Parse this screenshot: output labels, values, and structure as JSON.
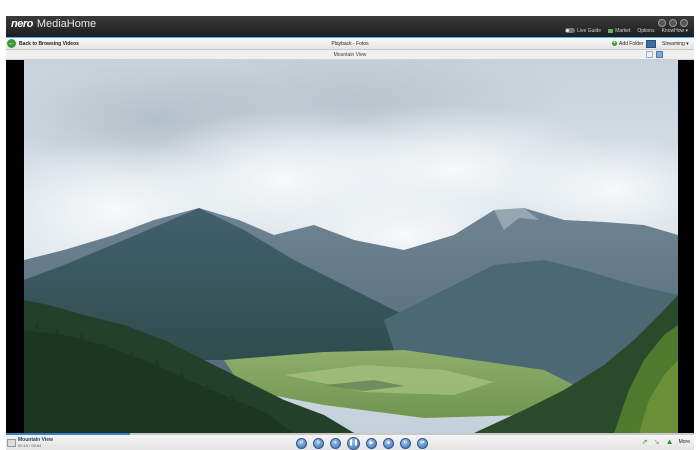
{
  "app": {
    "brand": "nero",
    "product": "MediaHome"
  },
  "topbar": {
    "live_guide": "Live Guide",
    "market": "Market",
    "options": "Options",
    "knowhow": "KnowHow ▾"
  },
  "nav": {
    "back_label": "Back to Browsing Videos",
    "title": "Playback - Fotos",
    "add_folder": "Add Folder",
    "streaming": "Streaming ▾"
  },
  "subbar": {
    "title": "Mountain View"
  },
  "player": {
    "media_title": "Mountain View",
    "time": "00:15 / 00:54",
    "progress": 0.18,
    "controls": [
      "rotate-left",
      "rotate-right",
      "zoom",
      "pause",
      "next",
      "slideshow",
      "repeat",
      "shuffle"
    ],
    "more_label": "More"
  }
}
